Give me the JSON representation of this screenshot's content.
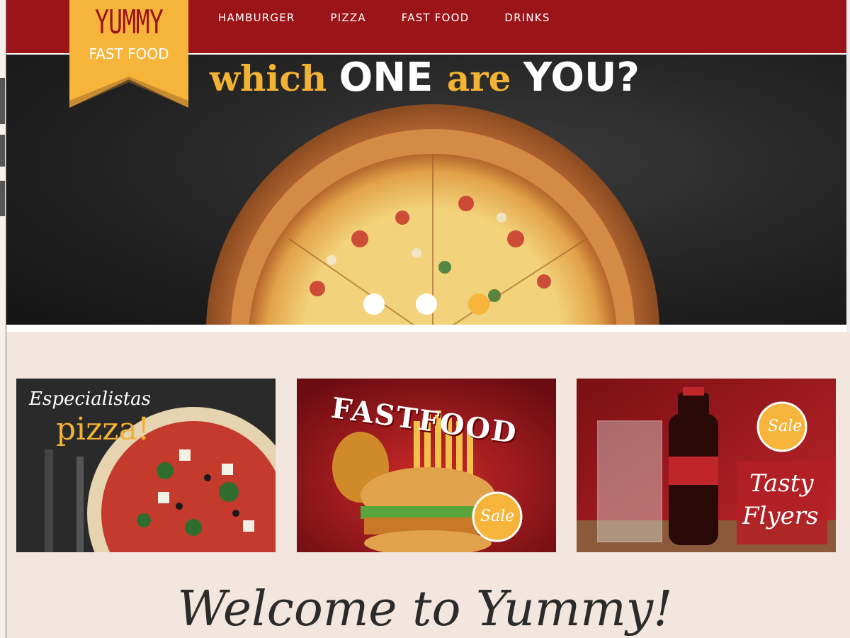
{
  "logo": {
    "title": "YUMMY",
    "subtitle": "FAST FOOD"
  },
  "nav": {
    "items": [
      "HAMBURGER",
      "PIZZA",
      "FAST FOOD",
      "DRINKS"
    ]
  },
  "hero": {
    "heading_part1": "which ",
    "heading_part2": "ONE ",
    "heading_part3": "are ",
    "heading_part4": "YOU?",
    "active_slide": 3,
    "slide_count": 3
  },
  "promos": [
    {
      "line1": "Especialistas",
      "line2": "pizza!"
    },
    {
      "title": "FASTFOOD",
      "badge": "Sale"
    },
    {
      "badge": "Sale",
      "line1": "Tasty",
      "line2": "Flyers"
    }
  ],
  "welcome": "Welcome to Yummy!",
  "colors": {
    "primary": "#9b1418",
    "accent": "#f7b43a",
    "background": "#f2e6de"
  }
}
